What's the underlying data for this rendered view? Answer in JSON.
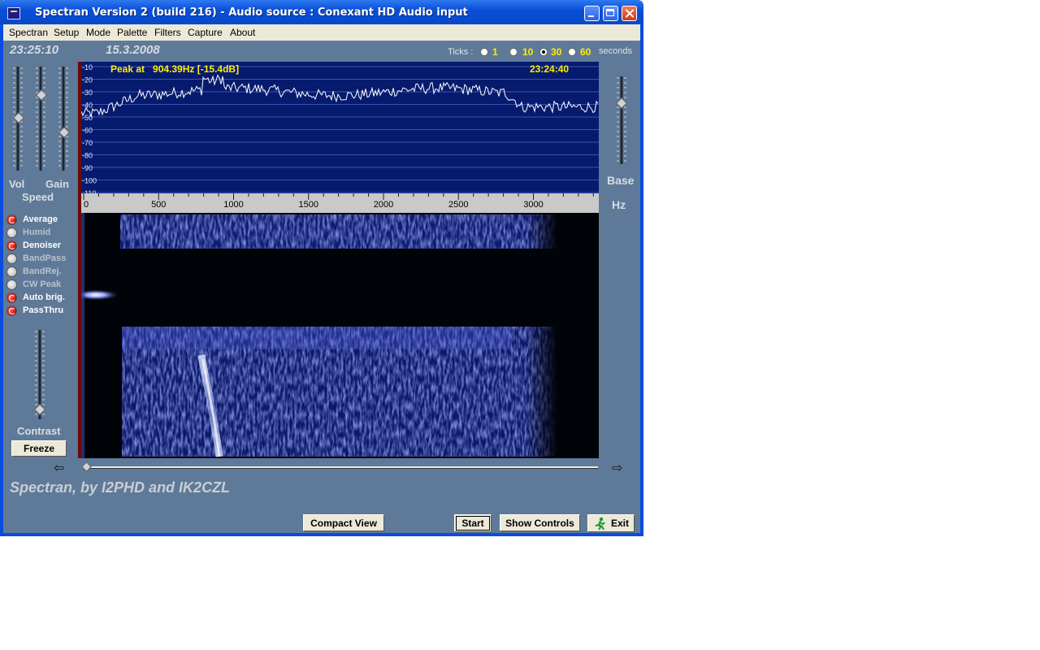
{
  "window": {
    "title": "Spectran Version 2 (build 216) - Audio source  :  Conexant HD Audio input",
    "controls": {
      "minimize": "minimize-icon",
      "maximize": "maximize-icon",
      "close": "close-icon"
    }
  },
  "menu": [
    "Spectran",
    "Setup",
    "Mode",
    "Palette",
    "Filters",
    "Capture",
    "About"
  ],
  "status": {
    "time": "23:25:10",
    "date": "15.3.2008"
  },
  "ticks": {
    "label": "Ticks :",
    "options": [
      {
        "value": "1",
        "selected": false
      },
      {
        "value": "10",
        "selected": false
      },
      {
        "value": "30",
        "selected": true
      },
      {
        "value": "60",
        "selected": false
      }
    ],
    "unit": "seconds"
  },
  "sliders": {
    "vol_label": "Vol",
    "gain_label": "Gain",
    "speed_label": "Speed",
    "base_label": "Base",
    "hz_label": "Hz",
    "contrast_label": "Contrast"
  },
  "filters": [
    {
      "label": "Average",
      "on": true
    },
    {
      "label": "Humid",
      "on": false
    },
    {
      "label": "Denoiser",
      "on": true
    },
    {
      "label": "BandPass",
      "on": false
    },
    {
      "label": "BandRej.",
      "on": false
    },
    {
      "label": "CW Peak",
      "on": false
    },
    {
      "label": "Auto brig.",
      "on": true
    },
    {
      "label": "PassThru",
      "on": true
    }
  ],
  "buttons": {
    "freeze": "Freeze",
    "compact": "Compact View",
    "start": "Start",
    "show_controls": "Show Controls",
    "exit": "Exit"
  },
  "spectrum": {
    "peak_text": "Peak at   904.39Hz [-15.4dB]",
    "timestamp": "23:24:40",
    "db_labels": [
      "-10",
      "-20",
      "-30",
      "-40",
      "-50",
      "-60",
      "-70",
      "-80",
      "-90",
      "-100",
      "-110"
    ],
    "freq_labels": [
      "0",
      "500",
      "1000",
      "1500",
      "2000",
      "2500",
      "3000"
    ],
    "colors": {
      "background": "#061a6e",
      "grid": "#3c52b0",
      "trace": "#ffffff",
      "peak_text": "#ffee00"
    }
  },
  "footer": {
    "brand": "Spectran, by I2PHD and IK2CZL"
  }
}
